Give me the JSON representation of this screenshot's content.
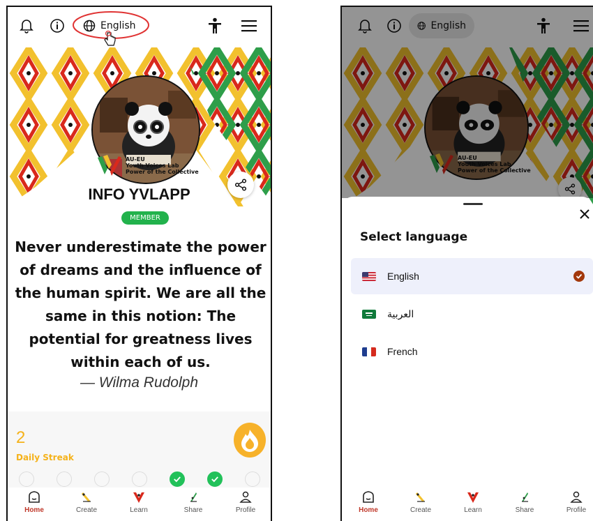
{
  "left_screen": {
    "topbar": {
      "language_label": "English"
    },
    "banner": {
      "logo_line1": "AU-EU",
      "logo_line2": "Youth Voices Lab",
      "logo_line3": "Power of the Collective"
    },
    "profile": {
      "name": "INFO YVLAPP",
      "badge": "MEMBER"
    },
    "quote": {
      "text": "Never underestimate the power of dreams and the influence of the human spirit. We are all the same in this notion: The potential for greatness lives within each of us.",
      "author": "— Wilma Rudolph"
    },
    "streak": {
      "count": "2",
      "label": "Daily Streak",
      "days_completed": [
        false,
        false,
        false,
        false,
        true,
        true,
        false
      ]
    }
  },
  "right_screen": {
    "topbar": {
      "language_label": "English"
    },
    "banner": {
      "logo_line1": "AU-EU",
      "logo_line2": "Youth Voices Lab",
      "logo_line3": "Power of the Collective"
    },
    "sheet": {
      "title": "Select language",
      "close_icon": "close-icon",
      "options": [
        {
          "label": "English",
          "flag": "us-flag",
          "selected": true
        },
        {
          "label": "العربية",
          "flag": "saudi-flag",
          "selected": false
        },
        {
          "label": "French",
          "flag": "france-flag",
          "selected": false
        }
      ]
    }
  },
  "bottom_nav": [
    {
      "label": "Home",
      "icon": "home-icon",
      "active": true
    },
    {
      "label": "Create",
      "icon": "create-icon",
      "active": false
    },
    {
      "label": "Learn",
      "icon": "learn-icon",
      "active": false
    },
    {
      "label": "Share",
      "icon": "share-nav-icon",
      "active": false
    },
    {
      "label": "Profile",
      "icon": "profile-icon",
      "active": false
    }
  ],
  "colors": {
    "member_green": "#22b24c",
    "streak_orange": "#f5b21a",
    "active_nav_red": "#c0392b",
    "check_brown": "#a3380c",
    "selected_row": "#eef0fb"
  }
}
